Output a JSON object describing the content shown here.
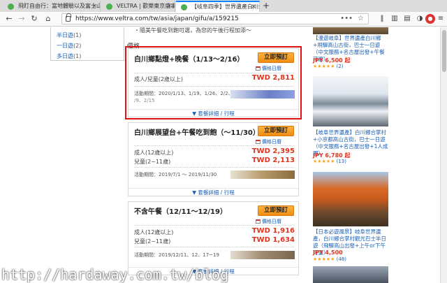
{
  "tabs": [
    {
      "label": "飛盯自由行：當地體驗以及富士山"
    },
    {
      "label": "VELTRA | 歡樂東京盛事 百萬..."
    },
    {
      "label": "【岐阜四季】世界遺產白川鄉..."
    }
  ],
  "toolbar": {
    "url": "https://www.veltra.com/tw/asia/japan/gifu/a/159215",
    "dots": "•••",
    "new_tab": "+",
    "close_glyph": "×"
  },
  "menu": {
    "items": [
      {
        "label": "半日遊",
        "count": "(1)"
      },
      {
        "label": "一日遊",
        "count": "(2)"
      },
      {
        "label": "多日遊",
        "count": "(1)"
      }
    ]
  },
  "intro_text": "・隨美午餐吃到飽可選，為您的午後行程加添～",
  "section_label": "價格",
  "cards": [
    {
      "title": "白川鄉點燈+晚餐（1/13～2/16）",
      "book_label": "立即預訂",
      "calendar_label": "價格日曆",
      "prices": [
        {
          "label": "成人/兒童(2歲以上)",
          "value": "TWD 2,811"
        }
      ],
      "period": "活動期間：2020/1/13、1/19、1/26、2/2、2",
      "period_cont": "/9、2/15",
      "detail_label": "▼ 套餐詳細 / 行程"
    },
    {
      "title": "白川鄉展望台+午餐吃到飽（～11/30）",
      "book_label": "立即預訂",
      "calendar_label": "價格日曆",
      "prices": [
        {
          "label": "成人(12歲以上)",
          "value": "TWD 2,395"
        },
        {
          "label": "兒童(2~11歲)",
          "value": "TWD 2,113"
        }
      ],
      "period": "活動期間：2019/7/1 ～ 2019/11/30",
      "detail_label": "▼ 套餐詳細 / 行程"
    },
    {
      "title": "不含午餐（12/11～12/19）",
      "book_label": "立即預訂",
      "calendar_label": "價格日曆",
      "prices": [
        {
          "label": "成人(12歲以上)",
          "value": "TWD 1,916"
        },
        {
          "label": "兒童(2~11歲)",
          "value": "TWD 1,634"
        }
      ],
      "period": "活動期間：2019/12/11、12、17~19",
      "detail_label": "▼ 套餐詳細 / 行程"
    }
  ],
  "side_tours": [
    {
      "title": "【漫遊岐阜】世界遺產白川鄉+飛驒高山古街，巴士一日遊（中文服務+名古屋出發+午餐可選）",
      "price": "JPY 6,500 起",
      "stars": "★★★★★",
      "count": "(2)"
    },
    {
      "title": "【岐阜世界遺產】白川鄉合掌村+小京都高山古街，巴士一日遊（中文服務+名古屋出發+1人成團）",
      "price": "JPY 6,780 起",
      "stars": "★★★★★",
      "count": "(13)"
    },
    {
      "title": "【日本必遊風景】岐阜世界遺產，白川鄉合掌村觀光巴士半日遊（飛驒高山出發+上午or下午可選）",
      "price": "JPY 4,500",
      "stars": "★★★★★",
      "count": "(48)"
    }
  ],
  "watermark": "http://hardaway.com.tw/blog"
}
